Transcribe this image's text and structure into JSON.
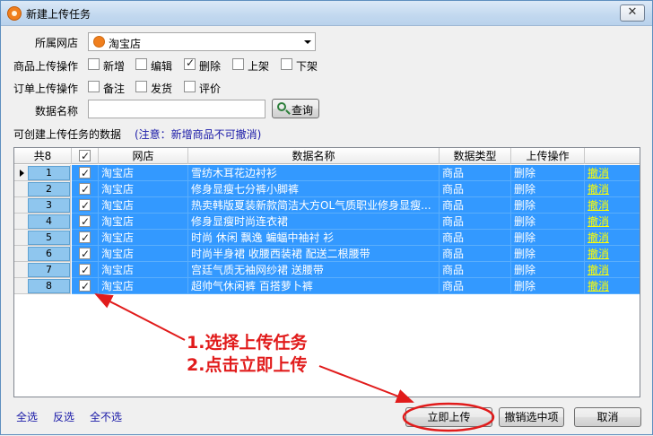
{
  "window": {
    "title": "新建上传任务",
    "close_glyph": "✕"
  },
  "form": {
    "shop_label": "所属网店",
    "shop_value": "淘宝店",
    "product_ops_label": "商品上传操作",
    "product_ops": [
      {
        "label": "新增",
        "checked": false
      },
      {
        "label": "编辑",
        "checked": false
      },
      {
        "label": "删除",
        "checked": true
      },
      {
        "label": "上架",
        "checked": false
      },
      {
        "label": "下架",
        "checked": false
      }
    ],
    "order_ops_label": "订单上传操作",
    "order_ops": [
      {
        "label": "备注",
        "checked": false
      },
      {
        "label": "发货",
        "checked": false
      },
      {
        "label": "评价",
        "checked": false
      }
    ],
    "data_name_label": "数据名称",
    "data_name_value": "",
    "query_label": "查询",
    "section_label": "可创建上传任务的数据",
    "note": "(注意：新增商品不可撤消)"
  },
  "grid": {
    "count_header": "共8",
    "headers": [
      "网店",
      "数据名称",
      "数据类型",
      "上传操作"
    ],
    "rows": [
      {
        "n": "1",
        "shop": "淘宝店",
        "name": "雪纺木耳花边衬衫",
        "type": "商品",
        "op": "删除",
        "action": "撤消"
      },
      {
        "n": "2",
        "shop": "淘宝店",
        "name": "修身显瘦七分裤小脚裤",
        "type": "商品",
        "op": "删除",
        "action": "撤消"
      },
      {
        "n": "3",
        "shop": "淘宝店",
        "name": "热卖韩版夏装新款简洁大方OL气质职业修身显瘦...",
        "type": "商品",
        "op": "删除",
        "action": "撤消"
      },
      {
        "n": "4",
        "shop": "淘宝店",
        "name": "修身显瘦时尚连衣裙",
        "type": "商品",
        "op": "删除",
        "action": "撤消"
      },
      {
        "n": "5",
        "shop": "淘宝店",
        "name": "时尚 休闲 飘逸 蝙蝠中袖衬 衫",
        "type": "商品",
        "op": "删除",
        "action": "撤消"
      },
      {
        "n": "6",
        "shop": "淘宝店",
        "name": "时尚半身裙 收腰西装裙 配送二根腰带",
        "type": "商品",
        "op": "删除",
        "action": "撤消"
      },
      {
        "n": "7",
        "shop": "淘宝店",
        "name": "宫廷气质无袖网纱裙 送腰带",
        "type": "商品",
        "op": "删除",
        "action": "撤消"
      },
      {
        "n": "8",
        "shop": "淘宝店",
        "name": "超帅气休闲裤 百搭萝卜裤",
        "type": "商品",
        "op": "删除",
        "action": "撤消"
      }
    ]
  },
  "footer": {
    "select_all": "全选",
    "invert": "反选",
    "select_none": "全不选",
    "upload_now": "立即上传",
    "cancel_selected": "撤销选中项",
    "cancel": "取消"
  },
  "annotation": {
    "line1": "1.选择上传任务",
    "line2": "2.点击立即上传",
    "color": "#e11b1b"
  }
}
